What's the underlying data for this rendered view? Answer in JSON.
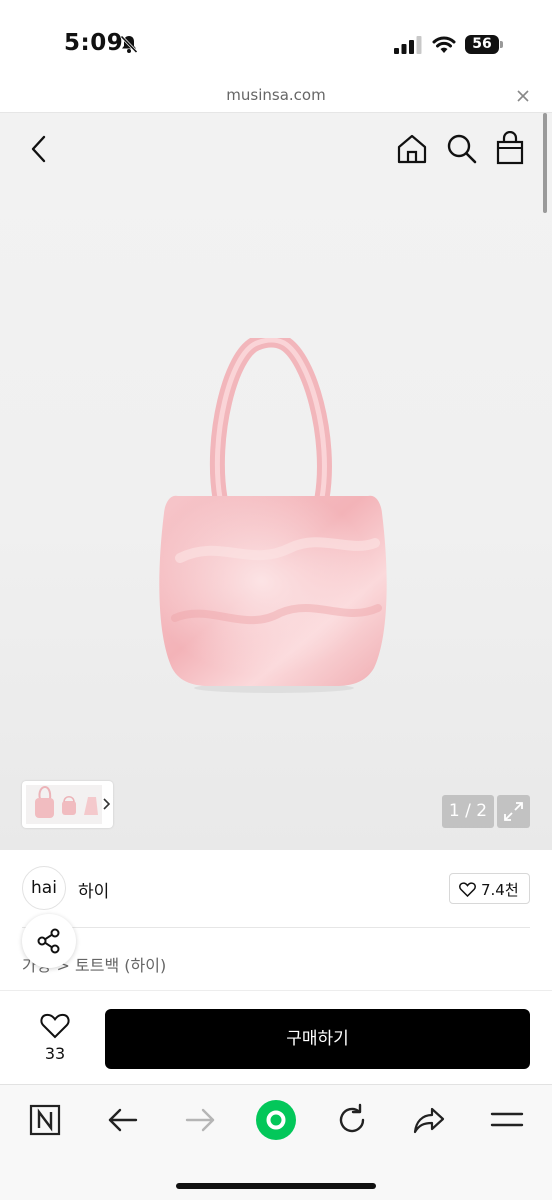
{
  "status_bar": {
    "time": "5:09",
    "battery": "56"
  },
  "browser": {
    "url": "musinsa.com"
  },
  "product": {
    "image_counter": "1 / 2",
    "brand": {
      "logo_text": "hai",
      "name": "하이",
      "likes": "7.4천"
    },
    "category": "가방 > 토트백 (하이)",
    "wish_count": "33",
    "buy_label": "구매하기"
  },
  "icons": {
    "nav": [
      "back-icon",
      "home-icon",
      "search-icon",
      "shopping-bag-icon"
    ],
    "toolbar": [
      "naver-n-icon",
      "arrow-left-icon",
      "arrow-right-icon",
      "green-dot-icon",
      "reload-icon",
      "share-arrow-icon",
      "menu-icon"
    ]
  },
  "colors": {
    "accent_green": "#03c75a",
    "buy_button": "#000000",
    "product_pink": "#f2b8bd"
  }
}
